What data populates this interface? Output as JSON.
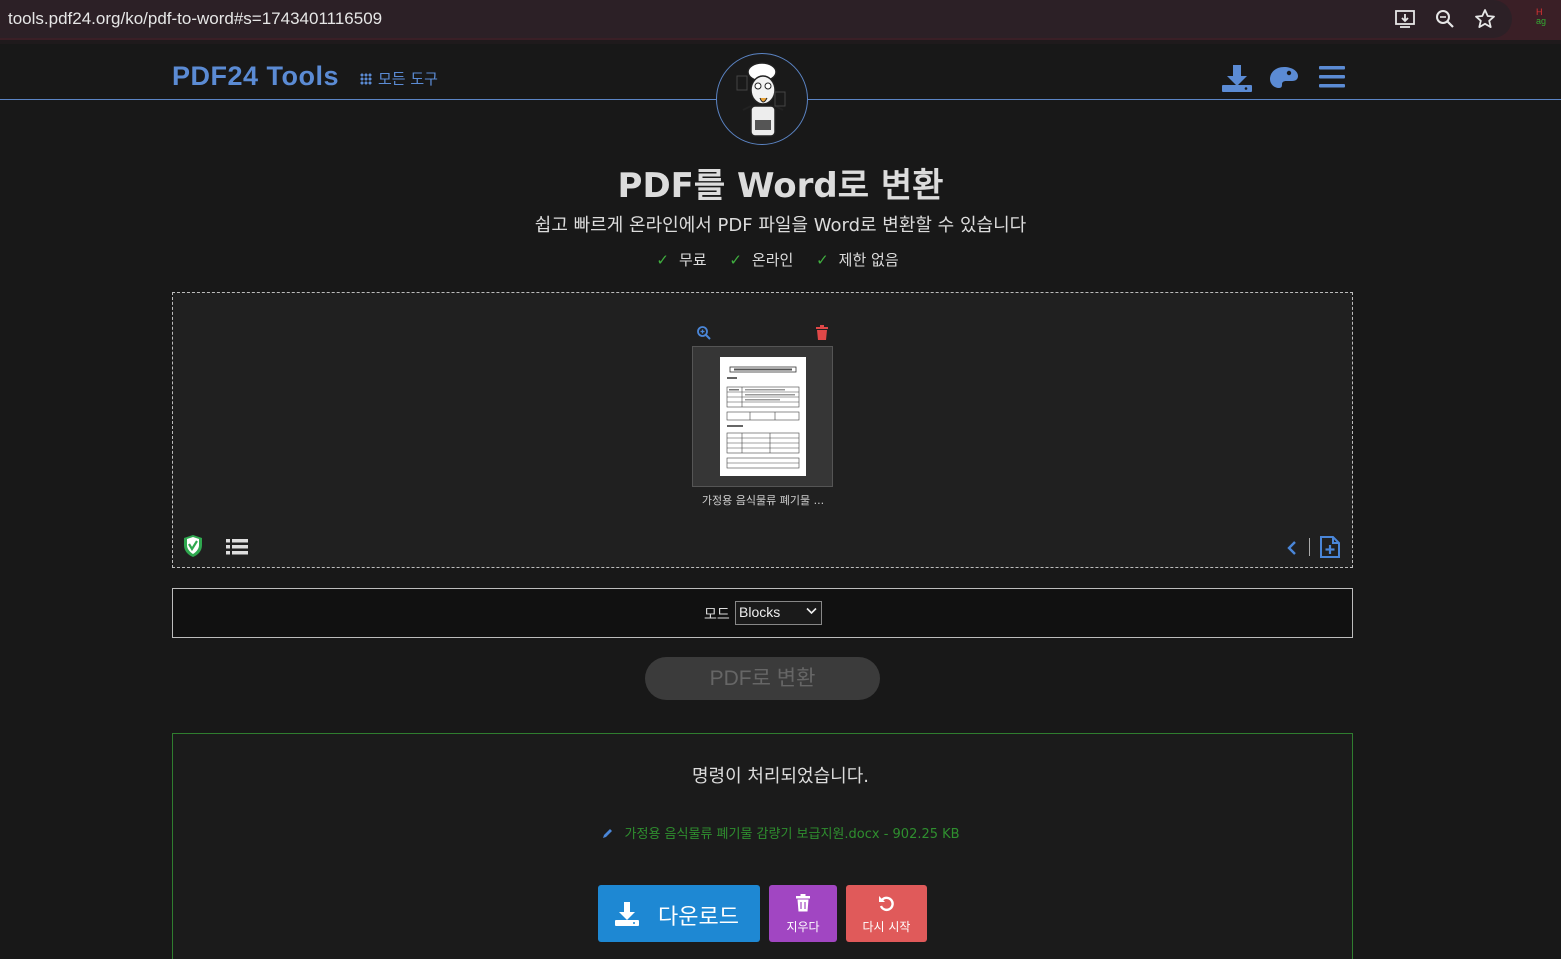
{
  "browser": {
    "url": "tools.pdf24.org/ko/pdf-to-word#s=1743401116509",
    "extension_badge_top": "H",
    "extension_badge_bottom": "ag"
  },
  "header": {
    "brand": "PDF24 Tools",
    "all_tools": "모든 도구",
    "icons": [
      "download-icon",
      "palette-icon",
      "menu-icon"
    ]
  },
  "page": {
    "title": "PDF를 Word로 변환",
    "subtitle": "쉽고 빠르게 온라인에서 PDF 파일을 Word로 변환할 수 있습니다",
    "features": [
      "무료",
      "온라인",
      "제한 없음"
    ],
    "check_glyph": "✓"
  },
  "dropzone": {
    "file_name": "가정용 음식물류 폐기물 ..."
  },
  "mode": {
    "label": "모드",
    "selected": "Blocks"
  },
  "convert_button": "PDF로 변환",
  "result": {
    "message": "명령이 처리되었습니다.",
    "file_link": "가정용 음식물류 폐기물 감량기 보급지원.docx - 902.25 KB",
    "download_label": "다운로드",
    "delete_label": "지우다",
    "restart_label": "다시 시작"
  },
  "colors": {
    "accent": "#5b8bd4",
    "download": "#1e88d3",
    "delete": "#a146c2",
    "restart": "#e05a5a",
    "check": "#3fae3f",
    "result_border": "#2f7d2f"
  }
}
